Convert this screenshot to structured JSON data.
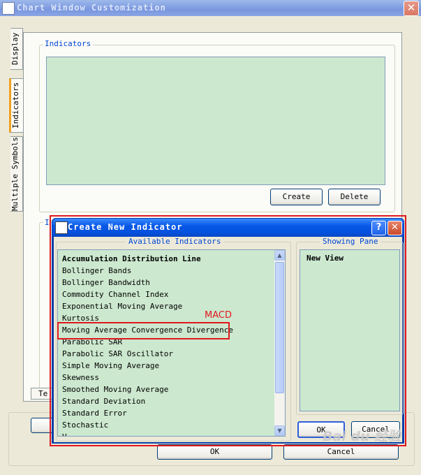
{
  "window": {
    "title": "Chart Window Customization",
    "close_glyph": "✕"
  },
  "tabs": [
    {
      "label": "Display"
    },
    {
      "label": "Indicators"
    },
    {
      "label": "Multiple Symbols"
    }
  ],
  "indicators_group": {
    "legend": "Indicators",
    "create_label": "Create",
    "delete_label": "Delete"
  },
  "lower_group": {
    "legend": "I",
    "tab_label": "Te"
  },
  "main_buttons": {
    "ok_label": "OK",
    "cancel_label": "Cancel"
  },
  "dialog": {
    "title": "Create New Indicator",
    "help_glyph": "?",
    "close_glyph": "✕",
    "available_legend": "Available Indicators",
    "available_items": [
      {
        "label": "Accumulation Distribution Line",
        "bold": true
      },
      {
        "label": "Bollinger Bands"
      },
      {
        "label": "Bollinger Bandwidth"
      },
      {
        "label": "Commodity Channel Index"
      },
      {
        "label": "Exponential Moving Average"
      },
      {
        "label": "Kurtosis"
      },
      {
        "label": "Moving Average Convergence Divergence",
        "highlighted": true
      },
      {
        "label": "Parabolic SAR"
      },
      {
        "label": "Parabolic SAR Oscillator"
      },
      {
        "label": "Simple Moving Average"
      },
      {
        "label": "Skewness"
      },
      {
        "label": "Smoothed Moving Average"
      },
      {
        "label": "Standard Deviation"
      },
      {
        "label": "Standard Error"
      },
      {
        "label": "Stochastic"
      },
      {
        "label": "V..."
      }
    ],
    "pane_legend": "Showing Pane",
    "pane_items": [
      "New View"
    ],
    "ok_label": "OK",
    "cancel_label": "Cancel"
  },
  "annotation": {
    "label": "MACD",
    "color": "#e0171d"
  },
  "watermark": "Bai du 经验",
  "colors": {
    "list_background": "#cce8cf",
    "dialog_titlebar": "#0858e6",
    "legend_text": "#0046d5"
  }
}
